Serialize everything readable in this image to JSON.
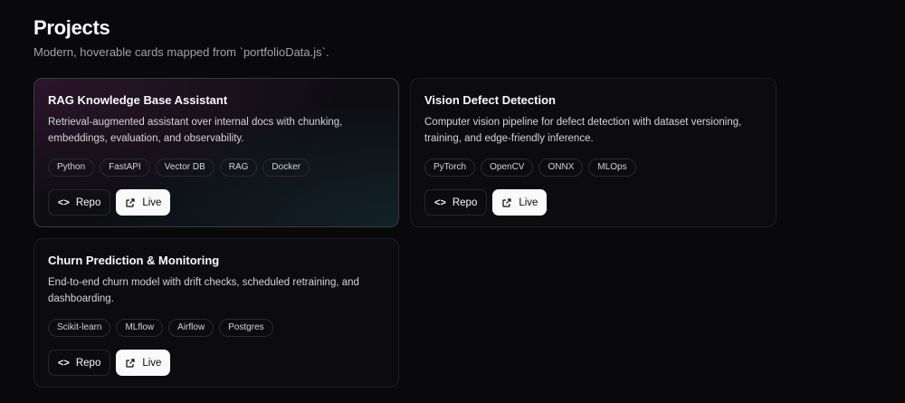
{
  "header": {
    "title": "Projects",
    "subtitle": "Modern, hoverable cards mapped from `portfolioData.js`."
  },
  "projects": [
    {
      "title": "RAG Knowledge Base Assistant",
      "description": "Retrieval-augmented assistant over internal docs with chunking, embeddings, evaluation, and observability.",
      "tags": [
        "Python",
        "FastAPI",
        "Vector DB",
        "RAG",
        "Docker"
      ],
      "repo_label": "Repo",
      "live_label": "Live"
    },
    {
      "title": "Vision Defect Detection",
      "description": "Computer vision pipeline for defect detection with dataset versioning, training, and edge-friendly inference.",
      "tags": [
        "PyTorch",
        "OpenCV",
        "ONNX",
        "MLOps"
      ],
      "repo_label": "Repo",
      "live_label": "Live"
    },
    {
      "title": "Churn Prediction & Monitoring",
      "description": "End-to-end churn model with drift checks, scheduled retraining, and dashboarding.",
      "tags": [
        "Scikit-learn",
        "MLflow",
        "Airflow",
        "Postgres"
      ],
      "repo_label": "Repo",
      "live_label": "Live"
    }
  ],
  "icons": {
    "repo": "code-icon",
    "live": "external-link-icon"
  }
}
